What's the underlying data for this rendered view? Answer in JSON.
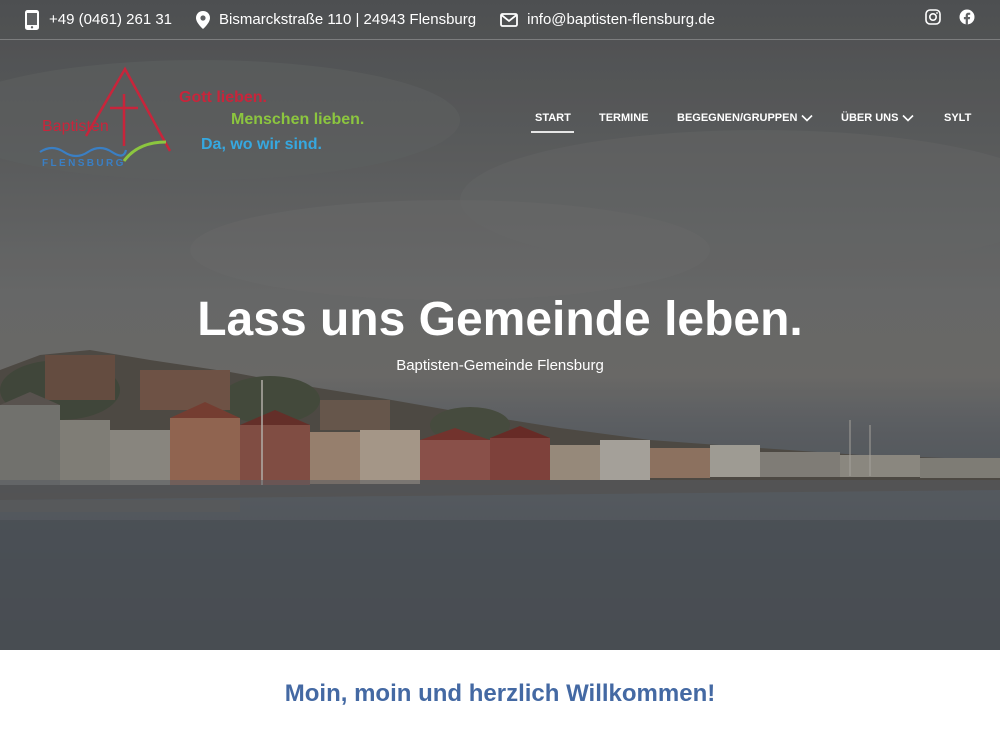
{
  "topbar": {
    "phone": "+49 (0461) 261 31",
    "address": "Bismarckstraße 110 | 24943 Flensburg",
    "email": "info@baptisten-flensburg.de",
    "icons": [
      "phone-icon",
      "location-pin-icon",
      "envelope-icon",
      "instagram-icon",
      "facebook-icon"
    ]
  },
  "logo": {
    "word": "Baptisten",
    "city": "FLENSBURG",
    "slogan_1": "Gott lieben.",
    "slogan_2": "Menschen lieben.",
    "slogan_3": "Da, wo wir sind.",
    "colors": {
      "red": "#c8253b",
      "green": "#8cc63f",
      "blue": "#36a8e0"
    }
  },
  "nav": {
    "items": [
      {
        "label": "START",
        "active": true
      },
      {
        "label": "TERMINE"
      },
      {
        "label": "BEGEGNEN/GRUPPEN",
        "dropdown": true
      },
      {
        "label": "ÜBER UNS",
        "dropdown": true
      },
      {
        "label": "SYLT"
      }
    ]
  },
  "hero": {
    "title": "Lass uns Gemeinde leben.",
    "subtitle": "Baptisten-Gemeinde Flensburg"
  },
  "welcome": {
    "heading": "Moin, moin und herzlich Willkommen!",
    "color": "#4469a3"
  }
}
